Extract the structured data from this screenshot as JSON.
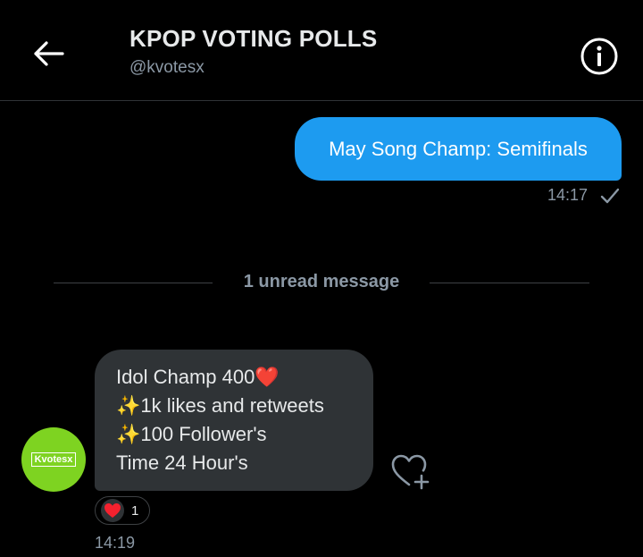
{
  "header": {
    "title": "KPOP VOTING POLLS",
    "handle": "@kvotesx"
  },
  "sent_message": {
    "text": "May Song Champ: Semifinals",
    "time": "14:17"
  },
  "divider": {
    "label": "1 unread message"
  },
  "received_message": {
    "avatar_text": "Kvotesx",
    "lines": [
      {
        "prefix": "",
        "text": "Idol Champ 400",
        "suffix": "❤️"
      },
      {
        "prefix": "✨",
        "text": "1k likes and retweets",
        "suffix": ""
      },
      {
        "prefix": "✨",
        "text": "100 Follower's",
        "suffix": ""
      },
      {
        "prefix": "",
        "text": "Time 24 Hour's",
        "suffix": ""
      }
    ],
    "reaction_count": "1",
    "time": "14:19"
  },
  "icons": {
    "back": "arrow-left-icon",
    "info": "info-icon",
    "read": "check-icon",
    "react": "heart-plus-icon",
    "reaction": "heart-icon"
  },
  "colors": {
    "background": "#000000",
    "sent_bubble": "#1d9bf0",
    "received_bubble": "#2f3336",
    "avatar": "#7ed321",
    "heart": "#f4212e"
  }
}
